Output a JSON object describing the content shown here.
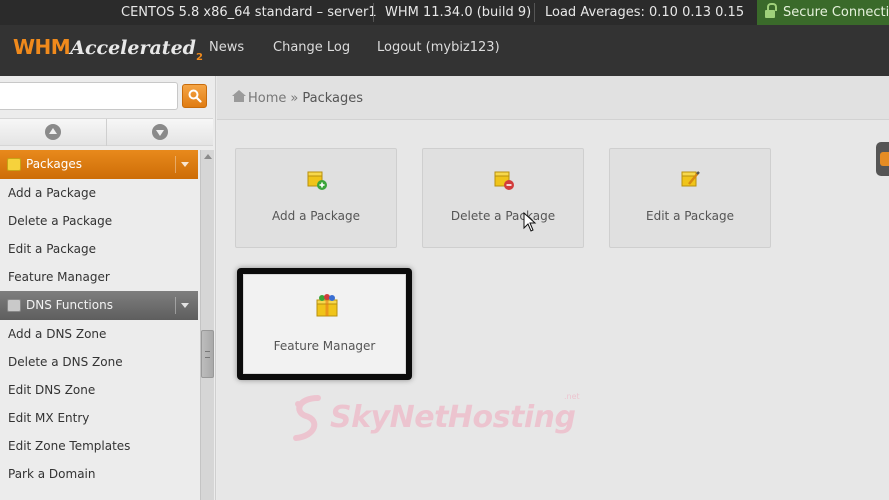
{
  "statusbar": {
    "system": "CENTOS 5.8 x86_64 standard – server1",
    "version": "WHM 11.34.0 (build 9)",
    "load": "Load Averages: 0.10 0.13 0.15",
    "secure": "Secure Connection"
  },
  "header": {
    "logo_whm": "WHM",
    "logo_accelerated": "Accelerated",
    "logo_version": "2",
    "nav": [
      "News",
      "Change Log",
      "Logout (mybiz123)"
    ]
  },
  "sidebar": {
    "search_value": "",
    "categories": [
      {
        "label": "Packages",
        "items": [
          "Add a Package",
          "Delete a Package",
          "Edit a Package",
          "Feature Manager"
        ]
      },
      {
        "label": "DNS Functions",
        "items": [
          "Add a DNS Zone",
          "Delete a DNS Zone",
          "Edit DNS Zone",
          "Edit MX Entry",
          "Edit Zone Templates",
          "Park a Domain"
        ]
      }
    ]
  },
  "breadcrumb": {
    "home": "Home",
    "separator": "»",
    "current": "Packages"
  },
  "tiles": [
    {
      "label": "Add a Package",
      "icon": "package-add-icon"
    },
    {
      "label": "Delete a Package",
      "icon": "package-delete-icon"
    },
    {
      "label": "Edit a Package",
      "icon": "package-edit-icon"
    },
    {
      "label": "Feature Manager",
      "icon": "feature-manager-icon"
    }
  ],
  "watermark": {
    "text": "SkyNetHosting",
    "suffix": ".net"
  },
  "colors": {
    "accent": "#e07c12",
    "header": "#333333",
    "secure": "#3a6a2a"
  }
}
